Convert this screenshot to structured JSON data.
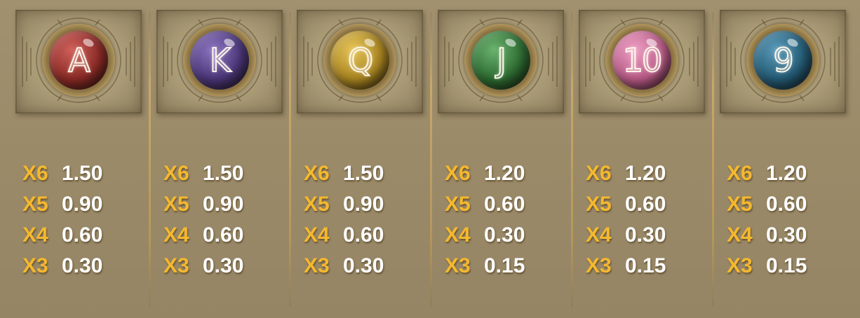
{
  "paytable": {
    "symbols": [
      {
        "symbol": "A",
        "orb_color": "#8a2a26",
        "orb_highlight": "#d0605a",
        "pays": [
          {
            "mult": "X6",
            "value": "1.50"
          },
          {
            "mult": "X5",
            "value": "0.90"
          },
          {
            "mult": "X4",
            "value": "0.60"
          },
          {
            "mult": "X3",
            "value": "0.30"
          }
        ]
      },
      {
        "symbol": "K",
        "orb_color": "#4a3678",
        "orb_highlight": "#8c74c0",
        "pays": [
          {
            "mult": "X6",
            "value": "1.50"
          },
          {
            "mult": "X5",
            "value": "0.90"
          },
          {
            "mult": "X4",
            "value": "0.60"
          },
          {
            "mult": "X3",
            "value": "0.30"
          }
        ]
      },
      {
        "symbol": "Q",
        "orb_color": "#a88420",
        "orb_highlight": "#e6c458",
        "pays": [
          {
            "mult": "X6",
            "value": "1.50"
          },
          {
            "mult": "X5",
            "value": "0.90"
          },
          {
            "mult": "X4",
            "value": "0.60"
          },
          {
            "mult": "X3",
            "value": "0.30"
          }
        ]
      },
      {
        "symbol": "J",
        "orb_color": "#2c6a30",
        "orb_highlight": "#6ab26e",
        "pays": [
          {
            "mult": "X6",
            "value": "1.20"
          },
          {
            "mult": "X5",
            "value": "0.60"
          },
          {
            "mult": "X4",
            "value": "0.30"
          },
          {
            "mult": "X3",
            "value": "0.15"
          }
        ]
      },
      {
        "symbol": "10",
        "orb_color": "#b85a86",
        "orb_highlight": "#eea0c4",
        "pays": [
          {
            "mult": "X6",
            "value": "1.20"
          },
          {
            "mult": "X5",
            "value": "0.60"
          },
          {
            "mult": "X4",
            "value": "0.30"
          },
          {
            "mult": "X3",
            "value": "0.15"
          }
        ]
      },
      {
        "symbol": "9",
        "orb_color": "#235a74",
        "orb_highlight": "#5a9ab8",
        "pays": [
          {
            "mult": "X6",
            "value": "1.20"
          },
          {
            "mult": "X5",
            "value": "0.60"
          },
          {
            "mult": "X4",
            "value": "0.30"
          },
          {
            "mult": "X3",
            "value": "0.15"
          }
        ]
      }
    ]
  },
  "colors": {
    "multiplier": "#f5b82e",
    "value": "#ffffff",
    "background": "#9e8e6c",
    "divider": "#c8a86a"
  }
}
